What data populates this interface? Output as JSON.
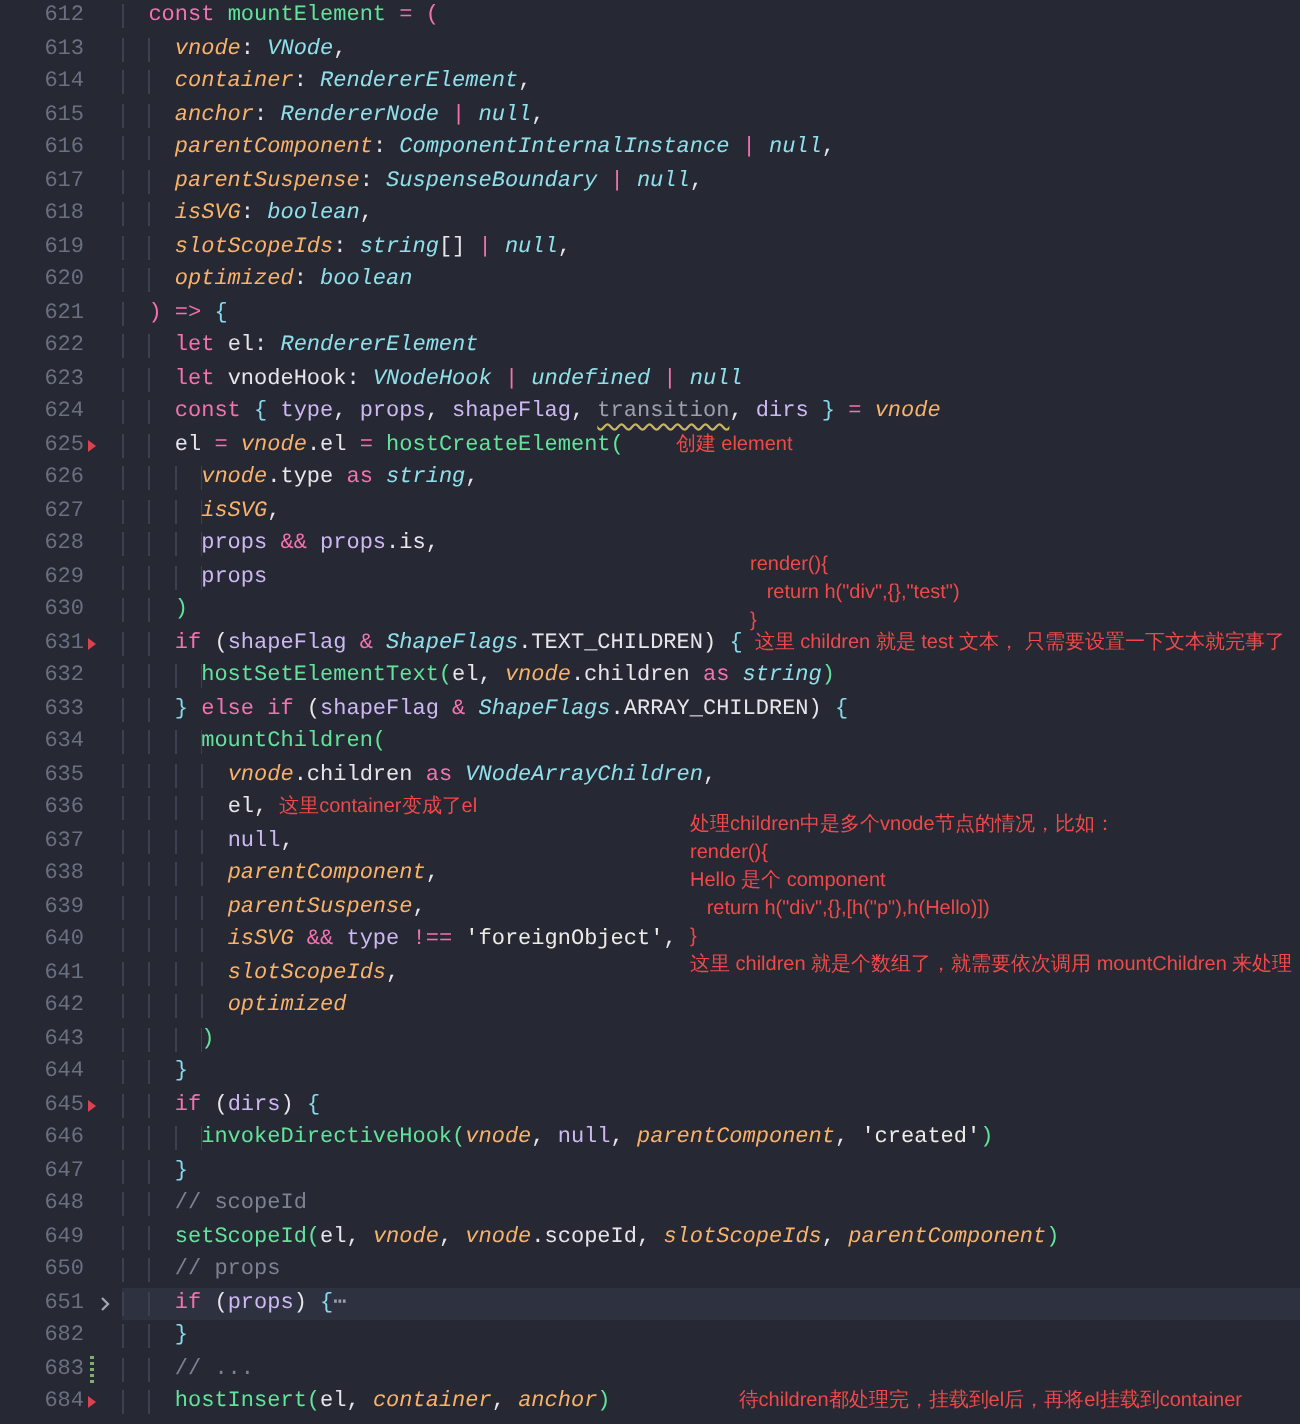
{
  "lines": [
    {
      "number": "612",
      "tokens": [
        {
          "kind": "keyword",
          "text": "  const "
        },
        {
          "kind": "function",
          "text": "mountElement "
        },
        {
          "kind": "keyword",
          "text": "= ("
        }
      ]
    },
    {
      "number": "613",
      "tokens": [
        {
          "kind": "param",
          "text": "    vnode"
        },
        {
          "kind": "plain",
          "text": ": "
        },
        {
          "kind": "type",
          "text": "VNode"
        },
        {
          "kind": "plain",
          "text": ","
        }
      ]
    },
    {
      "number": "614",
      "tokens": [
        {
          "kind": "param",
          "text": "    container"
        },
        {
          "kind": "plain",
          "text": ": "
        },
        {
          "kind": "type",
          "text": "RendererElement"
        },
        {
          "kind": "plain",
          "text": ","
        }
      ]
    },
    {
      "number": "615",
      "tokens": [
        {
          "kind": "param",
          "text": "    anchor"
        },
        {
          "kind": "plain",
          "text": ": "
        },
        {
          "kind": "type",
          "text": "RendererNode "
        },
        {
          "kind": "keyword",
          "text": "| "
        },
        {
          "kind": "type",
          "text": "null"
        },
        {
          "kind": "plain",
          "text": ","
        }
      ]
    },
    {
      "number": "616",
      "tokens": [
        {
          "kind": "param",
          "text": "    parentComponent"
        },
        {
          "kind": "plain",
          "text": ": "
        },
        {
          "kind": "type",
          "text": "ComponentInternalInstance "
        },
        {
          "kind": "keyword",
          "text": "| "
        },
        {
          "kind": "type",
          "text": "null"
        },
        {
          "kind": "plain",
          "text": ","
        }
      ]
    },
    {
      "number": "617",
      "tokens": [
        {
          "kind": "param",
          "text": "    parentSuspense"
        },
        {
          "kind": "plain",
          "text": ": "
        },
        {
          "kind": "type",
          "text": "SuspenseBoundary "
        },
        {
          "kind": "keyword",
          "text": "| "
        },
        {
          "kind": "type",
          "text": "null"
        },
        {
          "kind": "plain",
          "text": ","
        }
      ]
    },
    {
      "number": "618",
      "tokens": [
        {
          "kind": "param",
          "text": "    isSVG"
        },
        {
          "kind": "plain",
          "text": ": "
        },
        {
          "kind": "type",
          "text": "boolean"
        },
        {
          "kind": "plain",
          "text": ","
        }
      ]
    },
    {
      "number": "619",
      "tokens": [
        {
          "kind": "param",
          "text": "    slotScopeIds"
        },
        {
          "kind": "plain",
          "text": ": "
        },
        {
          "kind": "type",
          "text": "string"
        },
        {
          "kind": "plain",
          "text": "[] "
        },
        {
          "kind": "keyword",
          "text": "| "
        },
        {
          "kind": "type",
          "text": "null"
        },
        {
          "kind": "plain",
          "text": ","
        }
      ]
    },
    {
      "number": "620",
      "tokens": [
        {
          "kind": "param",
          "text": "    optimized"
        },
        {
          "kind": "plain",
          "text": ": "
        },
        {
          "kind": "type",
          "text": "boolean"
        }
      ]
    },
    {
      "number": "621",
      "tokens": [
        {
          "kind": "keyword",
          "text": "  ) => "
        },
        {
          "kind": "brace",
          "text": "{"
        }
      ]
    },
    {
      "number": "622",
      "tokens": [
        {
          "kind": "keyword",
          "text": "    let "
        },
        {
          "kind": "plain",
          "text": "el: "
        },
        {
          "kind": "type",
          "text": "RendererElement"
        }
      ]
    },
    {
      "number": "623",
      "tokens": [
        {
          "kind": "keyword",
          "text": "    let "
        },
        {
          "kind": "plain",
          "text": "vnodeHook: "
        },
        {
          "kind": "type",
          "text": "VNodeHook "
        },
        {
          "kind": "keyword",
          "text": "| "
        },
        {
          "kind": "type",
          "text": "undefined "
        },
        {
          "kind": "keyword",
          "text": "| "
        },
        {
          "kind": "type",
          "text": "null"
        }
      ]
    },
    {
      "number": "624",
      "tokens": [
        {
          "kind": "keyword",
          "text": "    const "
        },
        {
          "kind": "brace",
          "text": "{ "
        },
        {
          "kind": "variable",
          "text": "type"
        },
        {
          "kind": "plain",
          "text": ", "
        },
        {
          "kind": "variable",
          "text": "props"
        },
        {
          "kind": "plain",
          "text": ", "
        },
        {
          "kind": "variable",
          "text": "shapeFlag"
        },
        {
          "kind": "plain",
          "text": ", "
        },
        {
          "kind": "unused",
          "text": "transition"
        },
        {
          "kind": "plain",
          "text": ", "
        },
        {
          "kind": "variable",
          "text": "dirs "
        },
        {
          "kind": "brace",
          "text": "} "
        },
        {
          "kind": "keyword",
          "text": "= "
        },
        {
          "kind": "param",
          "text": "vnode"
        }
      ]
    },
    {
      "number": "625",
      "gutter_mark": {
        "kind": "deleted"
      },
      "note": "创建 element",
      "tokens": [
        {
          "kind": "plain",
          "text": "    el "
        },
        {
          "kind": "keyword",
          "text": "= "
        },
        {
          "kind": "param",
          "text": "vnode"
        },
        {
          "kind": "plain",
          "text": ".el "
        },
        {
          "kind": "keyword",
          "text": "= "
        },
        {
          "kind": "function",
          "text": "hostCreateElement("
        }
      ]
    },
    {
      "number": "626",
      "tokens": [
        {
          "kind": "param",
          "text": "      vnode"
        },
        {
          "kind": "plain",
          "text": ".type "
        },
        {
          "kind": "keyword",
          "text": "as "
        },
        {
          "kind": "type",
          "text": "string"
        },
        {
          "kind": "plain",
          "text": ","
        }
      ]
    },
    {
      "number": "627",
      "tokens": [
        {
          "kind": "param",
          "text": "      isSVG"
        },
        {
          "kind": "plain",
          "text": ","
        }
      ]
    },
    {
      "number": "628",
      "tokens": [
        {
          "kind": "variable",
          "text": "      props "
        },
        {
          "kind": "keyword",
          "text": "&& "
        },
        {
          "kind": "variable",
          "text": "props"
        },
        {
          "kind": "plain",
          "text": ".is,"
        }
      ]
    },
    {
      "number": "629",
      "tokens": [
        {
          "kind": "variable",
          "text": "      props"
        }
      ]
    },
    {
      "number": "630",
      "tokens": [
        {
          "kind": "function",
          "text": "    )"
        }
      ]
    },
    {
      "number": "631",
      "gutter_mark": {
        "kind": "deleted"
      },
      "note": "这里 children 就是 test 文本， 只需要设置一下文本就完事了",
      "tokens": [
        {
          "kind": "keyword",
          "text": "    if "
        },
        {
          "kind": "plain",
          "text": "("
        },
        {
          "kind": "variable",
          "text": "shapeFlag "
        },
        {
          "kind": "keyword",
          "text": "& "
        },
        {
          "kind": "type",
          "text": "ShapeFlags"
        },
        {
          "kind": "plain",
          "text": ".TEXT_CHILDREN) "
        },
        {
          "kind": "brace",
          "text": "{"
        }
      ]
    },
    {
      "number": "632",
      "tokens": [
        {
          "kind": "function",
          "text": "      hostSetElementText("
        },
        {
          "kind": "plain",
          "text": "el, "
        },
        {
          "kind": "param",
          "text": "vnode"
        },
        {
          "kind": "plain",
          "text": ".children "
        },
        {
          "kind": "keyword",
          "text": "as "
        },
        {
          "kind": "type",
          "text": "string"
        },
        {
          "kind": "function",
          "text": ")"
        }
      ]
    },
    {
      "number": "633",
      "tokens": [
        {
          "kind": "brace",
          "text": "    } "
        },
        {
          "kind": "keyword",
          "text": "else if "
        },
        {
          "kind": "plain",
          "text": "("
        },
        {
          "kind": "variable",
          "text": "shapeFlag "
        },
        {
          "kind": "keyword",
          "text": "& "
        },
        {
          "kind": "type",
          "text": "ShapeFlags"
        },
        {
          "kind": "plain",
          "text": ".ARRAY_CHILDREN) "
        },
        {
          "kind": "brace",
          "text": "{"
        }
      ]
    },
    {
      "number": "634",
      "tokens": [
        {
          "kind": "function",
          "text": "      mountChildren("
        }
      ]
    },
    {
      "number": "635",
      "tokens": [
        {
          "kind": "param",
          "text": "        vnode"
        },
        {
          "kind": "plain",
          "text": ".children "
        },
        {
          "kind": "keyword",
          "text": "as "
        },
        {
          "kind": "type",
          "text": "VNodeArrayChildren"
        },
        {
          "kind": "plain",
          "text": ","
        }
      ]
    },
    {
      "number": "636",
      "note": "这里container变成了el",
      "tokens": [
        {
          "kind": "plain",
          "text": "        el,"
        }
      ]
    },
    {
      "number": "637",
      "tokens": [
        {
          "kind": "variable",
          "text": "        null"
        },
        {
          "kind": "plain",
          "text": ","
        }
      ]
    },
    {
      "number": "638",
      "tokens": [
        {
          "kind": "param",
          "text": "        parentComponent"
        },
        {
          "kind": "plain",
          "text": ","
        }
      ]
    },
    {
      "number": "639",
      "tokens": [
        {
          "kind": "param",
          "text": "        parentSuspense"
        },
        {
          "kind": "plain",
          "text": ","
        }
      ]
    },
    {
      "number": "640",
      "tokens": [
        {
          "kind": "param",
          "text": "        isSVG "
        },
        {
          "kind": "keyword",
          "text": "&& "
        },
        {
          "kind": "variable",
          "text": "type "
        },
        {
          "kind": "keyword",
          "text": "!== "
        },
        {
          "kind": "string",
          "text": "'foreignObject'"
        },
        {
          "kind": "plain",
          "text": ","
        }
      ]
    },
    {
      "number": "641",
      "tokens": [
        {
          "kind": "param",
          "text": "        slotScopeIds"
        },
        {
          "kind": "plain",
          "text": ","
        }
      ]
    },
    {
      "number": "642",
      "tokens": [
        {
          "kind": "param",
          "text": "        optimized"
        }
      ]
    },
    {
      "number": "643",
      "tokens": [
        {
          "kind": "function",
          "text": "      )"
        }
      ]
    },
    {
      "number": "644",
      "tokens": [
        {
          "kind": "brace",
          "text": "    }"
        }
      ]
    },
    {
      "number": "645",
      "gutter_mark": {
        "kind": "deleted"
      },
      "tokens": [
        {
          "kind": "keyword",
          "text": "    if "
        },
        {
          "kind": "plain",
          "text": "("
        },
        {
          "kind": "variable",
          "text": "dirs"
        },
        {
          "kind": "plain",
          "text": ") "
        },
        {
          "kind": "brace",
          "text": "{"
        }
      ]
    },
    {
      "number": "646",
      "tokens": [
        {
          "kind": "function",
          "text": "      invokeDirectiveHook("
        },
        {
          "kind": "param",
          "text": "vnode"
        },
        {
          "kind": "plain",
          "text": ", "
        },
        {
          "kind": "variable",
          "text": "null"
        },
        {
          "kind": "plain",
          "text": ", "
        },
        {
          "kind": "param",
          "text": "parentComponent"
        },
        {
          "kind": "plain",
          "text": ", "
        },
        {
          "kind": "string",
          "text": "'created'"
        },
        {
          "kind": "function",
          "text": ")"
        }
      ]
    },
    {
      "number": "647",
      "tokens": [
        {
          "kind": "brace",
          "text": "    }"
        }
      ]
    },
    {
      "number": "648",
      "tokens": [
        {
          "kind": "comment",
          "text": "    // scopeId"
        }
      ]
    },
    {
      "number": "649",
      "tokens": [
        {
          "kind": "function",
          "text": "    setScopeId("
        },
        {
          "kind": "plain",
          "text": "el, "
        },
        {
          "kind": "param",
          "text": "vnode"
        },
        {
          "kind": "plain",
          "text": ", "
        },
        {
          "kind": "param",
          "text": "vnode"
        },
        {
          "kind": "plain",
          "text": ".scopeId, "
        },
        {
          "kind": "param",
          "text": "slotScopeIds"
        },
        {
          "kind": "plain",
          "text": ", "
        },
        {
          "kind": "param",
          "text": "parentComponent"
        },
        {
          "kind": "function",
          "text": ")"
        }
      ]
    },
    {
      "number": "650",
      "tokens": [
        {
          "kind": "comment",
          "text": "    // props"
        }
      ]
    },
    {
      "number": "651",
      "folded": true,
      "current": true,
      "tokens": [
        {
          "kind": "keyword",
          "text": "    if "
        },
        {
          "kind": "plain",
          "text": "("
        },
        {
          "kind": "variable",
          "text": "props"
        },
        {
          "kind": "plain",
          "text": ") "
        },
        {
          "kind": "brace",
          "text": "{"
        },
        {
          "kind": "fold",
          "text": "⋯"
        }
      ]
    },
    {
      "number": "682",
      "tokens": [
        {
          "kind": "brace",
          "text": "    }"
        }
      ]
    },
    {
      "number": "683",
      "gutter_mark": {
        "kind": "changed"
      },
      "tokens": [
        {
          "kind": "comment",
          "text": "    // ..."
        }
      ]
    },
    {
      "number": "684",
      "gutter_mark": {
        "kind": "deleted"
      },
      "note": "待children都处理完，挂载到el后，再将el挂载到container",
      "tokens": [
        {
          "kind": "function",
          "text": "    hostInsert("
        },
        {
          "kind": "plain",
          "text": "el, "
        },
        {
          "kind": "param",
          "text": "container"
        },
        {
          "kind": "plain",
          "text": ", "
        },
        {
          "kind": "param",
          "text": "anchor"
        },
        {
          "kind": "function",
          "text": ")"
        }
      ]
    }
  ],
  "annotations": [
    {
      "lines": [
        "render(){",
        "   return h(\"div\",{},\"test\")",
        "}"
      ]
    },
    {
      "lines": [
        "处理children中是多个vnode节点的情况，比如：",
        "render(){",
        "Hello 是个 component",
        "   return h(\"div\",{},[h(\"p\"),h(Hello)])",
        "}",
        "这里 children 就是个数组了，就需要依次调用 mountChildren 来处理"
      ]
    }
  ]
}
